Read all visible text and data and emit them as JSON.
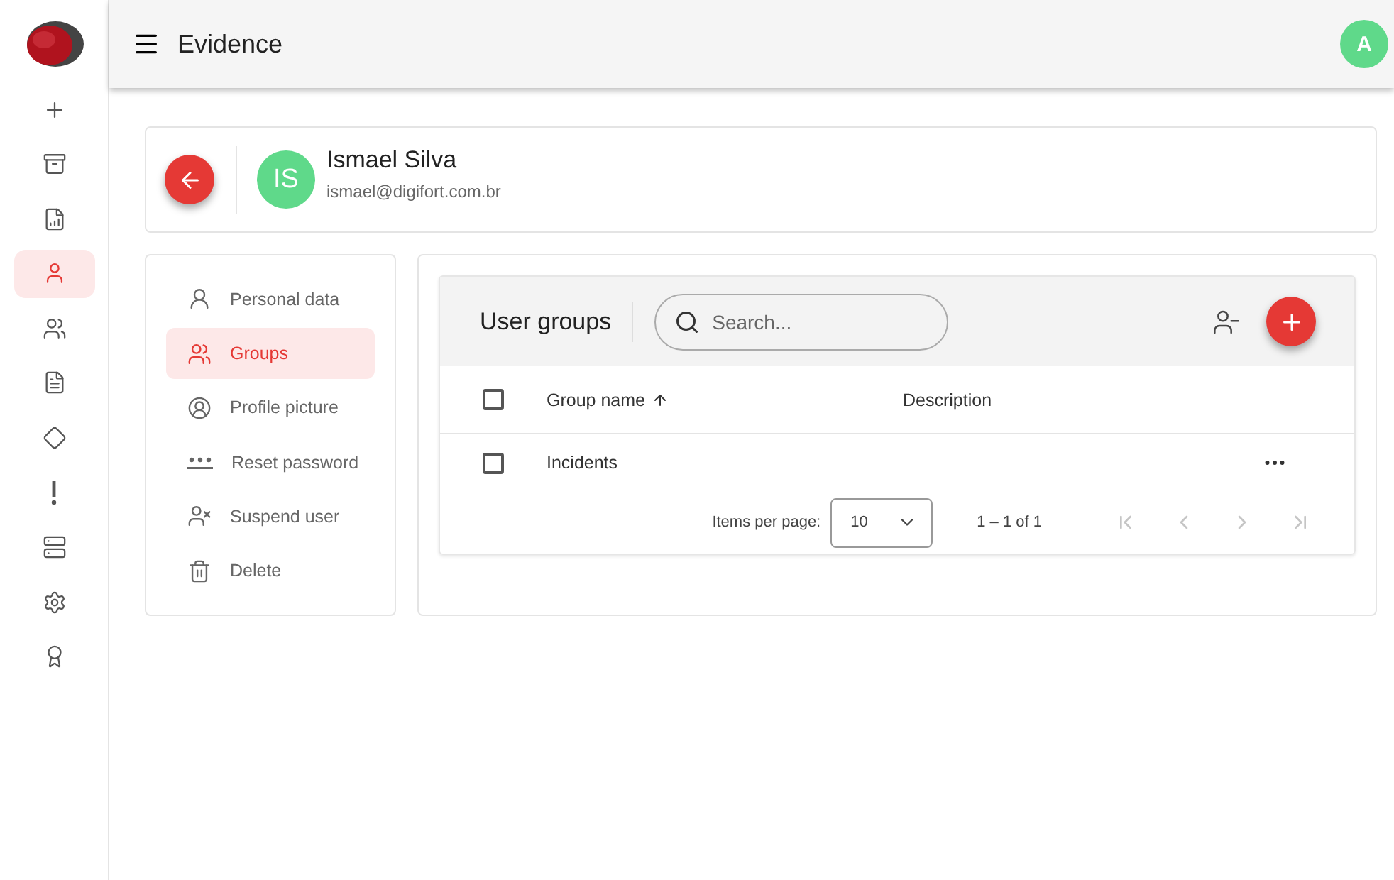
{
  "rail": {
    "items": [
      {
        "kind": "add",
        "selected": false
      },
      {
        "kind": "archive",
        "selected": false
      },
      {
        "kind": "report",
        "selected": false
      },
      {
        "kind": "user",
        "selected": true
      },
      {
        "kind": "users",
        "selected": false
      },
      {
        "kind": "document",
        "selected": false
      },
      {
        "kind": "warning",
        "selected": false
      },
      {
        "kind": "alert",
        "selected": false
      },
      {
        "kind": "server",
        "selected": false
      },
      {
        "kind": "settings",
        "selected": false
      },
      {
        "kind": "award",
        "selected": false
      }
    ]
  },
  "topbar": {
    "title": "Evidence",
    "avatar": "A"
  },
  "profile": {
    "initials": "IS",
    "name": "Ismael Silva",
    "email": "ismael@digifort.com.br"
  },
  "menu": [
    {
      "kind": "person",
      "label": "Personal data",
      "selected": false
    },
    {
      "kind": "groups",
      "label": "Groups",
      "selected": true
    },
    {
      "kind": "picture",
      "label": "Profile picture",
      "selected": false
    },
    {
      "kind": "password",
      "label": "Reset password",
      "selected": false
    },
    {
      "kind": "suspend",
      "label": "Suspend user",
      "selected": false
    },
    {
      "kind": "delete",
      "label": "Delete",
      "selected": false
    }
  ],
  "panel": {
    "title": "User groups",
    "search": {
      "placeholder": "Search..."
    },
    "columns": [
      "Group name",
      "Description"
    ],
    "header_checked": false,
    "rows": [
      {
        "name": "Incidents",
        "description": "",
        "checked": false
      }
    ],
    "pagination": {
      "label": "Items per page:",
      "page_size": "10",
      "range": "1 – 1 of 1"
    }
  }
}
